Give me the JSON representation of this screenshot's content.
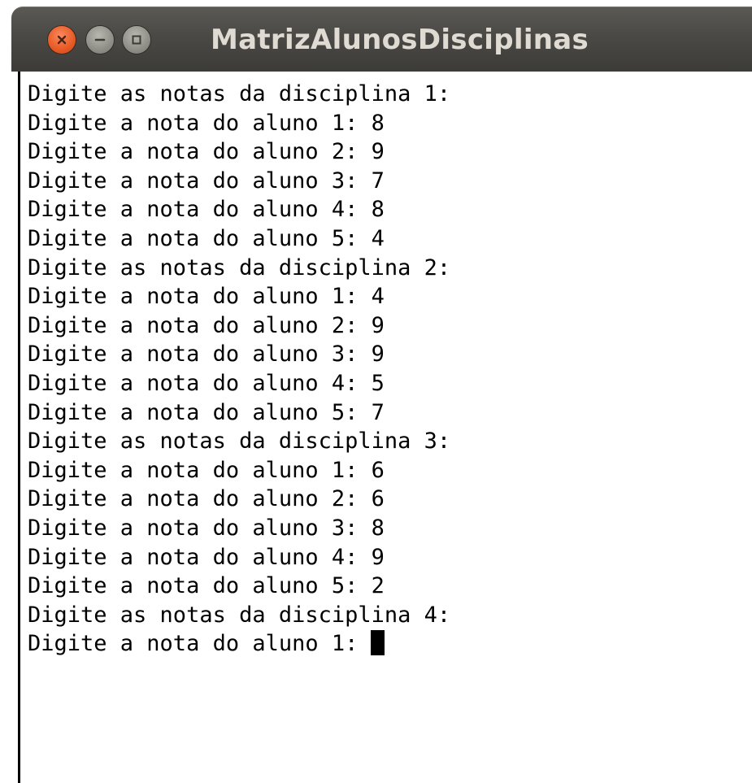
{
  "window": {
    "title": "MatrizAlunosDisciplinas",
    "buttons": {
      "close": "close-icon",
      "minimize": "minimize-icon",
      "maximize": "maximize-icon"
    },
    "colors": {
      "titlebar": "#3c3b37",
      "close": "#e85d28",
      "title_text": "#dfdbd2"
    }
  },
  "terminal": {
    "lines": [
      "Digite as notas da disciplina 1:",
      "Digite a nota do aluno 1: 8",
      "Digite a nota do aluno 2: 9",
      "Digite a nota do aluno 3: 7",
      "Digite a nota do aluno 4: 8",
      "Digite a nota do aluno 5: 4",
      "Digite as notas da disciplina 2:",
      "Digite a nota do aluno 1: 4",
      "Digite a nota do aluno 2: 9",
      "Digite a nota do aluno 3: 9",
      "Digite a nota do aluno 4: 5",
      "Digite a nota do aluno 5: 7",
      "Digite as notas da disciplina 3:",
      "Digite a nota do aluno 1: 6",
      "Digite a nota do aluno 2: 6",
      "Digite a nota do aluno 3: 8",
      "Digite a nota do aluno 4: 9",
      "Digite a nota do aluno 5: 2",
      "Digite as notas da disciplina 4:"
    ],
    "prompt": "Digite a nota do aluno 1:"
  }
}
